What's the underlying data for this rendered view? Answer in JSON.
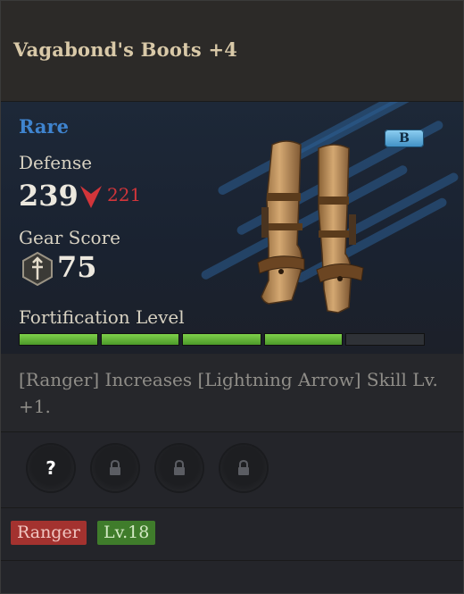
{
  "item": {
    "name": "Vagabond's Boots +4",
    "rarity": "Rare",
    "grade": "B"
  },
  "stats": {
    "defense_label": "Defense",
    "defense_value": "239",
    "defense_compare": "221",
    "gear_score_label": "Gear Score",
    "gear_score_value": "75",
    "fortification_label": "Fortification Level",
    "fortification_filled": 4,
    "fortification_total": 5
  },
  "effect": {
    "text": "[Ranger] Increases [Lightning Arrow] Skill Lv. +1."
  },
  "sockets": [
    {
      "icon": "question-icon",
      "symbol": "?"
    },
    {
      "icon": "lock-icon"
    },
    {
      "icon": "lock-icon"
    },
    {
      "icon": "lock-icon"
    }
  ],
  "tags": {
    "class": "Ranger",
    "level": "Lv.18"
  },
  "colors": {
    "rarity": "#3f84cf",
    "decrease": "#d2353a",
    "fortification": "#6cc23d",
    "class_tag": "#a3322f",
    "level_tag": "#3f7c2b"
  }
}
